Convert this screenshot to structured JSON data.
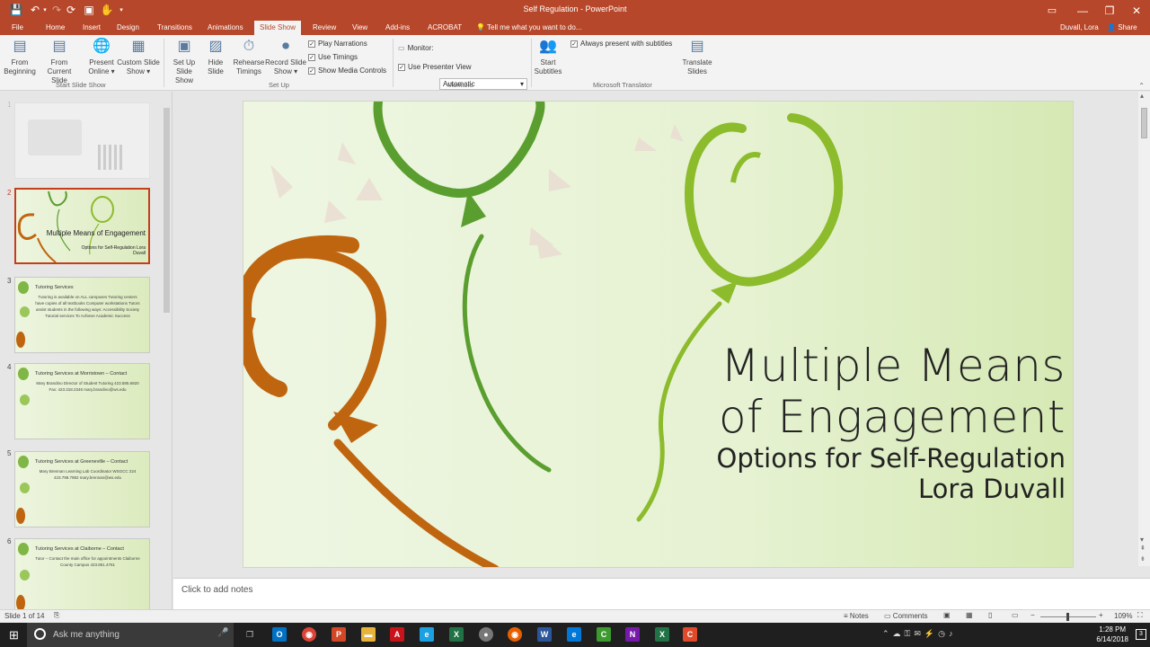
{
  "window": {
    "title": "Self Regulation - PowerPoint",
    "user": "Duvall, Lora",
    "share": "Share"
  },
  "tabs": [
    "File",
    "Home",
    "Insert",
    "Design",
    "Transitions",
    "Animations",
    "Slide Show",
    "Review",
    "View",
    "Add-ins",
    "ACROBAT"
  ],
  "active_tab": "Slide Show",
  "tell_me": "Tell me what you want to do...",
  "ribbon": {
    "start_slide_show": {
      "label": "Start Slide Show",
      "from_beginning": "From Beginning",
      "from_current": "From Current Slide",
      "present_online": "Present Online",
      "custom_show": "Custom Slide Show"
    },
    "set_up": {
      "label": "Set Up",
      "setup_show": "Set Up Slide Show",
      "hide_slide": "Hide Slide",
      "rehearse": "Rehearse Timings",
      "record": "Record Slide Show",
      "play_narrations": "Play Narrations",
      "use_timings": "Use Timings",
      "show_media_controls": "Show Media Controls"
    },
    "monitors": {
      "label": "Monitors",
      "monitor": "Monitor:",
      "monitor_value": "Automatic",
      "use_presenter_view": "Use Presenter View"
    },
    "translator": {
      "label": "Microsoft Translator",
      "start_subtitles": "Start Subtitles",
      "always_present": "Always present with subtitles",
      "translate_slides": "Translate Slides"
    }
  },
  "thumbnails": [
    {
      "num": "1",
      "title": "",
      "body": ""
    },
    {
      "num": "2",
      "title": "Multiple Means of Engagement",
      "body": "Options for Self-Regulation Lora Duvall"
    },
    {
      "num": "3",
      "title": "Tutoring Services",
      "body": "Tutoring is available on ALL campuses Tutoring centers have copies of all textbooks Computer workstations Tutors assist students in the following ways: Accessibility Society Tutorial services To Achieve Academic Success"
    },
    {
      "num": "4",
      "title": "Tutoring Services at Morristown – Contact",
      "body": "Mary Brandino Director of Student Tutoring 423.585.6920 Fax: 423.318.2346 mary.brandino@ws.edu"
    },
    {
      "num": "5",
      "title": "Tutoring Services at Greeneville – Contact",
      "body": "Mary Brennan Learning Lab Coordinator WSGCC 224 423.798.7982 mary.brennan@ws.edu"
    },
    {
      "num": "6",
      "title": "Tutoring Services at Claiborne – Contact",
      "body": "Tutor – Contact the main office for appointments Claiborne County Campus 423.851.4761"
    }
  ],
  "slide": {
    "title_line1": "Multiple Means",
    "title_line2": "of Engagement",
    "subtitle": "Options for Self-Regulation",
    "author": "Lora Duvall"
  },
  "notes_placeholder": "Click to add notes",
  "status": {
    "slide_info": "Slide 1 of 14",
    "notes": "Notes",
    "comments": "Comments",
    "zoom": "109%"
  },
  "taskbar": {
    "search": "Ask me anything",
    "time": "1:28 PM",
    "date": "6/14/2018",
    "notif_count": "3"
  },
  "colors": {
    "accent": "#b7472a",
    "balloon_green": "#5a9e2f",
    "balloon_lime": "#8cbb2c",
    "balloon_orange": "#c0650f"
  }
}
